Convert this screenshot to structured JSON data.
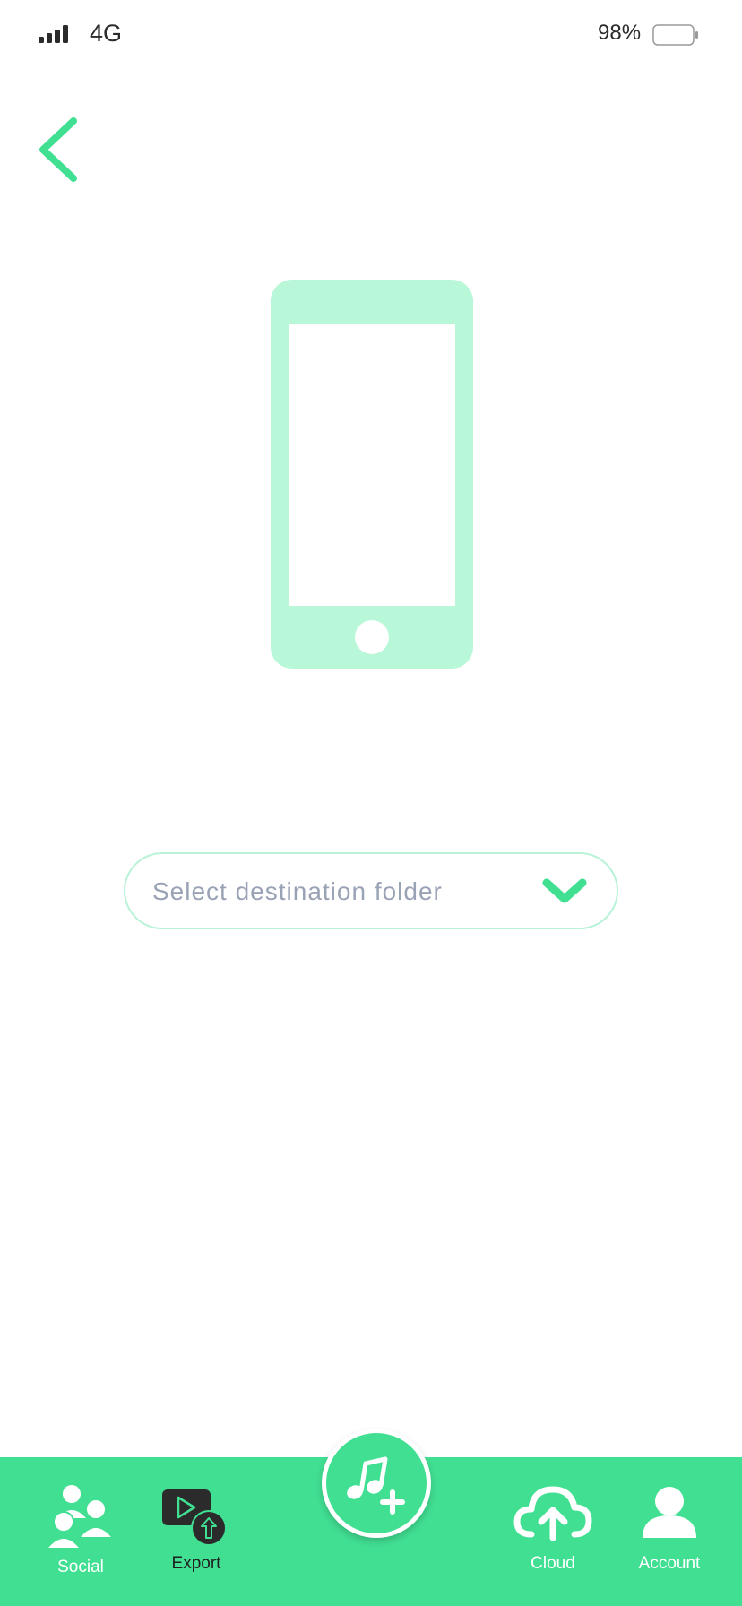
{
  "status_bar": {
    "network": "4G",
    "battery_percent": "98%",
    "signal_icon": "cellular-signal-icon",
    "battery_icon": "battery-icon",
    "battery_level": 0.98
  },
  "header": {
    "back_icon": "chevron-left-icon"
  },
  "illustration": {
    "icon": "smartphone-icon"
  },
  "folder_select": {
    "placeholder": "Select destination folder",
    "icon": "chevron-down-icon"
  },
  "bottom_nav": {
    "items": [
      {
        "label": "Social",
        "icon": "people-icon"
      },
      {
        "label": "Export",
        "icon": "export-video-icon"
      },
      {
        "label": "Cloud",
        "icon": "cloud-upload-icon"
      },
      {
        "label": "Account",
        "icon": "user-icon"
      }
    ],
    "center_action": {
      "icon": "add-music-icon"
    }
  },
  "colors": {
    "accent": "#41df92",
    "accent_light": "#b8f7d8",
    "placeholder_text": "#9aa3b6",
    "text_dark": "#2b2b2b"
  }
}
